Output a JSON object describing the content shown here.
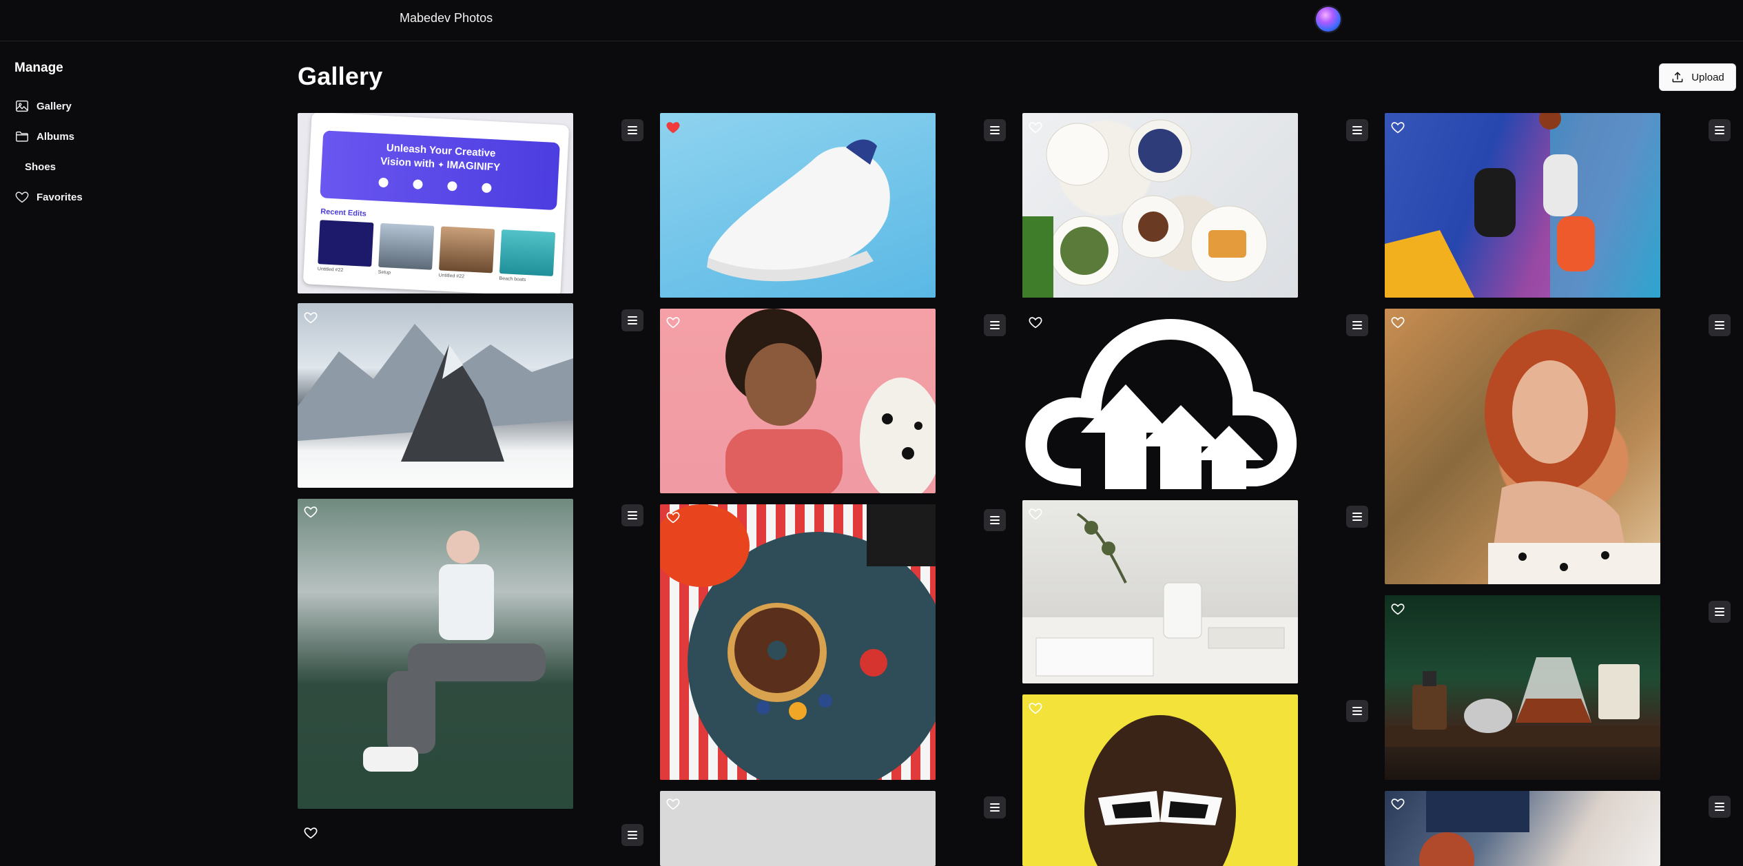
{
  "app": {
    "title": "Mabedev Photos"
  },
  "sidebar": {
    "heading": "Manage",
    "items": [
      {
        "label": "Gallery",
        "icon": "image-icon"
      },
      {
        "label": "Albums",
        "icon": "folder-icon"
      },
      {
        "label": "Shoes",
        "icon": ""
      },
      {
        "label": "Favorites",
        "icon": "heart-icon"
      }
    ]
  },
  "main": {
    "title": "Gallery",
    "upload_label": "Upload"
  },
  "imaginify": {
    "headline_1": "Unleash Your Creative",
    "headline_2": "Vision with",
    "brand": "IMAGINIFY",
    "recent": "Recent Edits",
    "captions": [
      "Untitled #22",
      "Setup",
      "Untitled #22",
      "Beach boats"
    ]
  },
  "tiles": [
    {
      "photo": "imaginify-screenshot",
      "favorited": false
    },
    {
      "photo": "white-sneaker",
      "favorited": true
    },
    {
      "photo": "breakfast-table",
      "favorited": false
    },
    {
      "photo": "basketball-players",
      "favorited": false
    },
    {
      "photo": "snowy-mountain",
      "favorited": false
    },
    {
      "photo": "smiling-woman-dog",
      "favorited": false
    },
    {
      "photo": "cloud-upload-logo",
      "favorited": false
    },
    {
      "photo": "redhead-portrait",
      "favorited": false
    },
    {
      "photo": "street-fashion",
      "favorited": false
    },
    {
      "photo": "donut-plate",
      "favorited": false
    },
    {
      "photo": "desk-mug",
      "favorited": false
    },
    {
      "photo": "coffee-set",
      "favorited": false
    },
    {
      "photo": "sunglasses-man",
      "favorited": false
    },
    {
      "photo": "gray-photo",
      "favorited": false
    },
    {
      "photo": "dark-photo",
      "favorited": false
    },
    {
      "photo": "fashion-store",
      "favorited": false
    }
  ],
  "colors": {
    "background": "#0b0b0e",
    "favorite_red": "#ef3b3b",
    "menu_button": "#2a2a2f"
  }
}
